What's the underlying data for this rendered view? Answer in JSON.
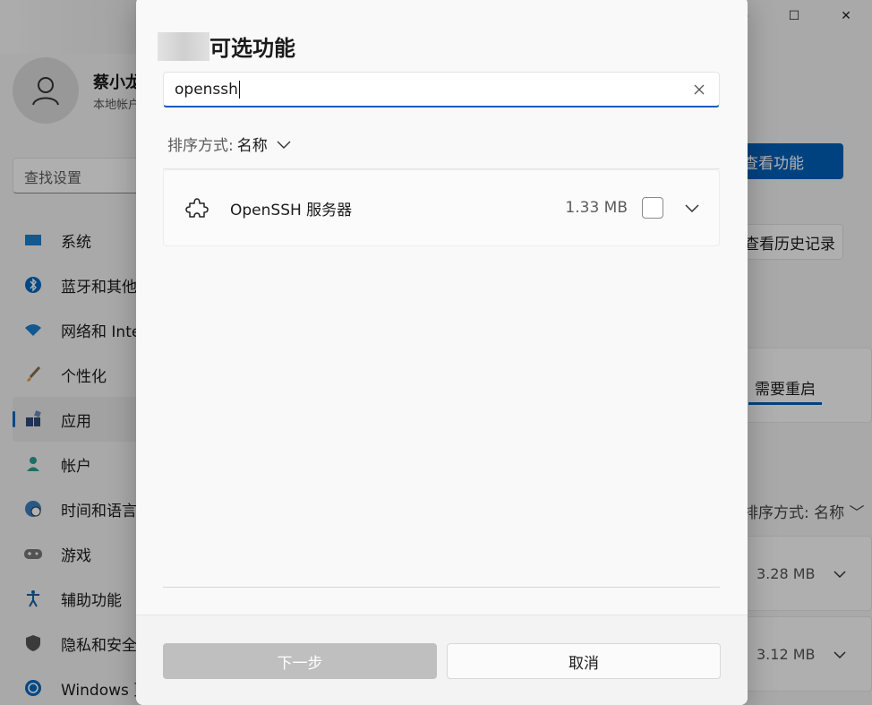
{
  "background": {
    "window_controls": [
      "—",
      "☐",
      "✕"
    ],
    "user": {
      "name": "蔡小龙",
      "subtitle": "本地帐户"
    },
    "search_placeholder": "查找设置",
    "nav": [
      {
        "label": "系统",
        "icon": "monitor-icon",
        "active": false
      },
      {
        "label": "蓝牙和其他设备",
        "icon": "bluetooth-icon",
        "active": false
      },
      {
        "label": "网络和 Internet",
        "icon": "wifi-icon",
        "active": false
      },
      {
        "label": "个性化",
        "icon": "brush-icon",
        "active": false
      },
      {
        "label": "应用",
        "icon": "apps-icon",
        "active": true
      },
      {
        "label": "帐户",
        "icon": "person-icon",
        "active": false
      },
      {
        "label": "时间和语言",
        "icon": "globe-clock-icon",
        "active": false
      },
      {
        "label": "游戏",
        "icon": "gamepad-icon",
        "active": false
      },
      {
        "label": "辅助功能",
        "icon": "accessibility-icon",
        "active": false
      },
      {
        "label": "隐私和安全性",
        "icon": "shield-icon",
        "active": false
      },
      {
        "label": "Windows 更新",
        "icon": "update-icon",
        "active": false
      }
    ],
    "right": {
      "view_features_btn": "查看功能",
      "history_btn": "查看历史记录",
      "restart_tab": "需要重启",
      "sort_label": "排序方式:",
      "sort_value": "名称",
      "rows": [
        {
          "size": "3.28 MB"
        },
        {
          "size": "3.12 MB"
        }
      ]
    }
  },
  "dialog": {
    "title": "可选功能",
    "search_value": "openssh",
    "sort_label": "排序方式:",
    "sort_value": "名称",
    "features": [
      {
        "name": "OpenSSH 服务器",
        "size": "1.33 MB",
        "checked": false
      }
    ],
    "next_button": "下一步",
    "cancel_button": "取消"
  },
  "colors": {
    "accent": "#005fb8",
    "disabled_button": "#bfbfbf"
  }
}
